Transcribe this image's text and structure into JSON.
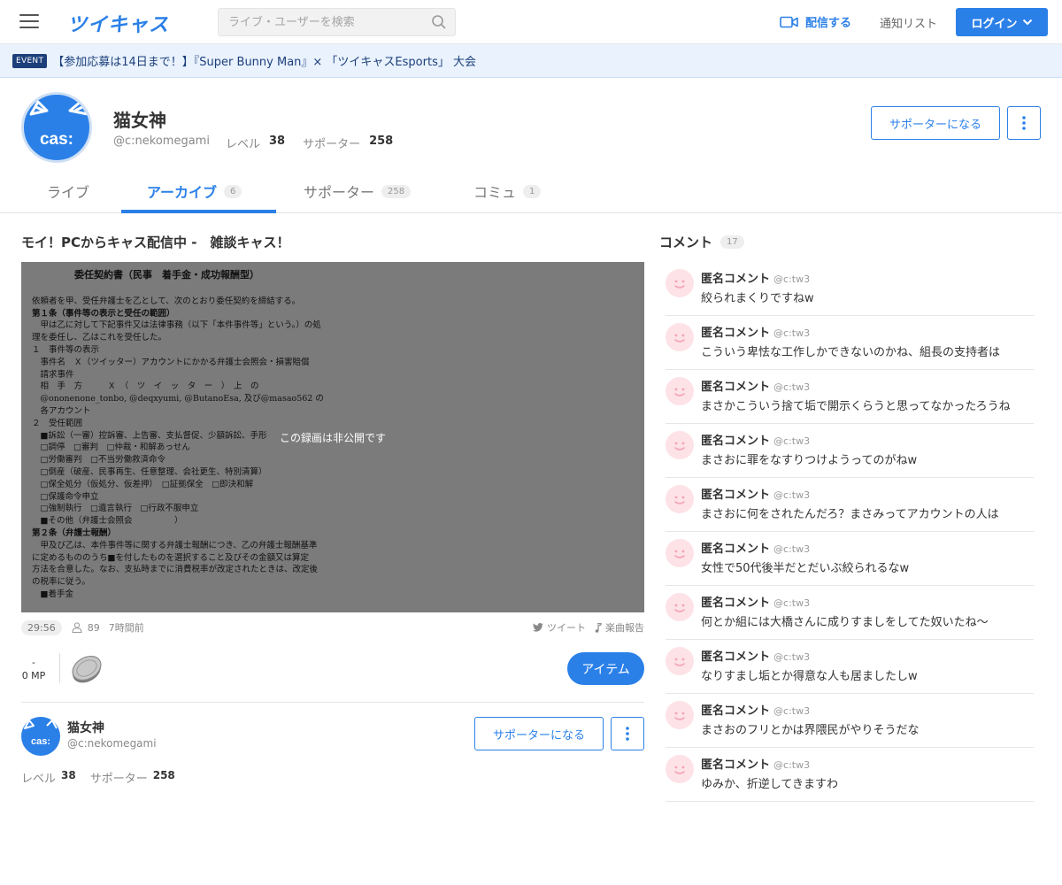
{
  "header": {
    "logo": "ツイキャス",
    "search_placeholder": "ライブ・ユーザーを検索",
    "broadcast_label": "配信する",
    "notify_label": "通知リスト",
    "login_label": "ログイン"
  },
  "event": {
    "badge": "EVENT",
    "text": "【参加応募は14日まで！】『Super Bunny Man』× 「ツイキャスEsports」 大会"
  },
  "profile": {
    "avatar_text": "cas:",
    "name": "猫女神",
    "user_id": "@c:nekomegami",
    "level_label": "レベル",
    "level": "38",
    "supporter_label": "サポーター",
    "supporter_count": "258",
    "become_supporter": "サポーターになる"
  },
  "tabs": [
    {
      "label": "ライブ",
      "count": ""
    },
    {
      "label": "アーカイブ",
      "count": "6"
    },
    {
      "label": "サポーター",
      "count": "258"
    },
    {
      "label": "コミュ",
      "count": "1"
    }
  ],
  "movie": {
    "title": "モイ！PCからキャス配信中 -　雑談キャス！",
    "private_message": "この録画は非公開です",
    "duration": "29:56",
    "viewers": "89",
    "time_ago": "7時間前",
    "tweet_label": "ツイート",
    "music_label": "楽曲報告",
    "mp_value": "-",
    "mp_unit": "0 MP",
    "item_button": "アイテム"
  },
  "document": {
    "heading": "委任契約書（民事　着手金・成功報酬型）",
    "lines": [
      "依頼者を甲、受任弁護士を乙として、次のとおり委任契約を締結する。",
      "第１条（事件等の表示と受任の範囲）",
      "　甲は乙に対して下記事件又は法律事務（以下「本件事件等」という。）の処",
      "理を委任し、乙はこれを受任した。",
      "１　事件等の表示",
      "　事件名　Ｘ（ツイッター）アカウントにかかる弁護士会照会・損害賠償",
      "　請求事件",
      "　相　手　方　　　Ｘ　（　ツ　イ　ッ　タ　ー　）　上　の",
      "　@ononenone_tonbo, @deqxyumi, @ButanoEsa, 及び@masao562 の",
      "　各アカウント",
      "２　受任範囲",
      "　■訴訟（一審）控訴審、上告審、支払督促、少額訴訟、手形",
      "　□調停　□審判　□仲裁・和解あっせん",
      "　□労働審判　□不当労働救済命令",
      "　□倒産（破産、民事再生、任意整理、会社更生、特別清算）",
      "　□保全処分（仮処分、仮差押）　□証拠保全　□即決和解",
      "　□保護命令申立",
      "　□強制執行　□遺言執行　□行政不服申立",
      "　■その他（弁護士会照会　　　　　）",
      "第２条（弁護士報酬）",
      "　甲及び乙は、本件事件等に関する弁護士報酬につき、乙の弁護士報酬基準",
      "に定めるもののうち■を付したものを選択すること及びその金額又は算定",
      "方法を合意した。なお、支払時までに消費税率が改定されたときは、改定後",
      "の税率に従う。",
      "　■着手金"
    ]
  },
  "owner": {
    "name": "猫女神",
    "user_id": "@c:nekomegami",
    "level_label": "レベル",
    "level": "38",
    "supporter_label": "サポーター",
    "supporter_count": "258",
    "become_supporter": "サポーターになる"
  },
  "comments": {
    "title": "コメント",
    "count": "17",
    "items": [
      {
        "name": "匿名コメント",
        "id": "@c:tw3",
        "text": "絞られまくりですねw"
      },
      {
        "name": "匿名コメント",
        "id": "@c:tw3",
        "text": "こういう卑怯な工作しかできないのかね、組長の支持者は"
      },
      {
        "name": "匿名コメント",
        "id": "@c:tw3",
        "text": "まさかこういう捨て垢で開示くらうと思ってなかったろうね"
      },
      {
        "name": "匿名コメント",
        "id": "@c:tw3",
        "text": "まさおに罪をなすりつけようってのがねw"
      },
      {
        "name": "匿名コメント",
        "id": "@c:tw3",
        "text": "まさおに何をされたんだろ？まさみってアカウントの人は"
      },
      {
        "name": "匿名コメント",
        "id": "@c:tw3",
        "text": "女性で50代後半だとだいぶ絞られるなw"
      },
      {
        "name": "匿名コメント",
        "id": "@c:tw3",
        "text": "何とか組には大橋さんに成りすましをしてた奴いたね〜"
      },
      {
        "name": "匿名コメント",
        "id": "@c:tw3",
        "text": "なりすまし垢とか得意な人も居ましたしw"
      },
      {
        "name": "匿名コメント",
        "id": "@c:tw3",
        "text": "まさおのフリとかは界隈民がやりそうだな"
      },
      {
        "name": "匿名コメント",
        "id": "@c:tw3",
        "text": "ゆみか、折逆してきますわ"
      }
    ]
  },
  "colors": {
    "accent": "#2b80e8",
    "event_bg": "#e9f2fd",
    "event_text": "#1c3f7a",
    "comment_avatar": "#fde2e7"
  }
}
